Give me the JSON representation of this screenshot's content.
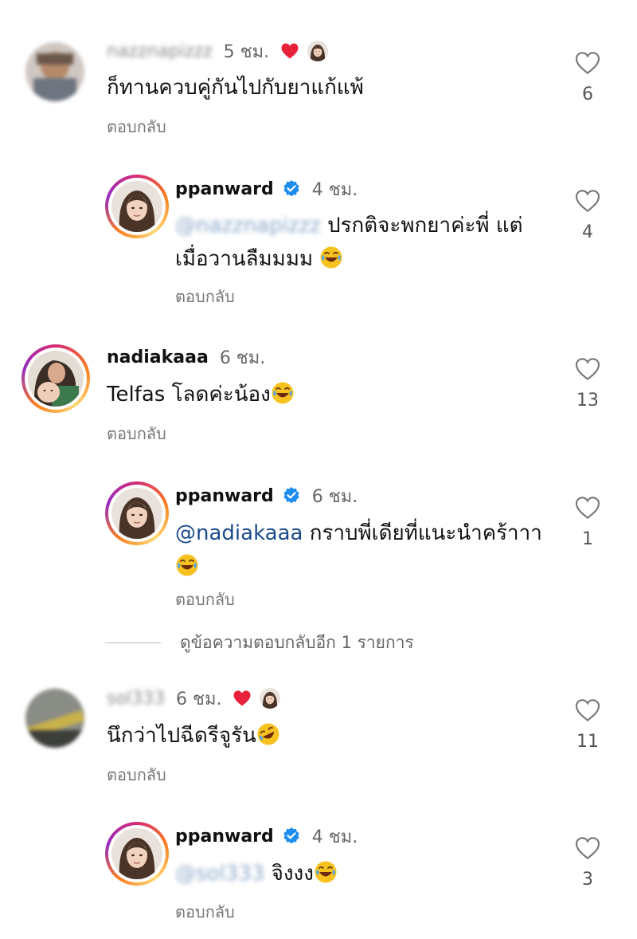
{
  "comments": [
    {
      "username": "nazznapizzz",
      "time": "5 ชม.",
      "text": "ก็ทานควบคู่กันไปกับยาแก้แพ้",
      "reply_label": "ตอบกลับ",
      "likes": "6",
      "liked_by_author": true
    },
    {
      "username": "ppanward",
      "verified": true,
      "time": "4 ชม.",
      "mention": "@nazznapizzz",
      "text_line1": "ปรกติจะพกยาค่ะพี่ แต่",
      "text_line2": "เมื่อวานลืมมมม",
      "reply_label": "ตอบกลับ",
      "likes": "4"
    },
    {
      "username": "nadiakaaa",
      "time": "6 ชม.",
      "text": "Telfas โลดค่ะน้อง",
      "reply_label": "ตอบกลับ",
      "likes": "13"
    },
    {
      "username": "ppanward",
      "verified": true,
      "time": "6 ชม.",
      "mention": "@nadiakaaa",
      "text": "กราบพี่เดียที่แนะนำคร้าาา",
      "reply_label": "ตอบกลับ",
      "likes": "1"
    },
    {
      "username": "sol333",
      "time": "6 ชม.",
      "text": "นึกว่าไปฉีดรีจูรัน",
      "reply_label": "ตอบกลับ",
      "likes": "11",
      "liked_by_author": true
    },
    {
      "username": "ppanward",
      "verified": true,
      "time": "4 ชม.",
      "mention": "@sol333",
      "text": "จิงงง",
      "reply_label": "ตอบกลับ",
      "likes": "3"
    }
  ],
  "view_more_replies": "ดูข้อความตอบกลับอีก 1 รายการ",
  "colors": {
    "heart_red": "#e8213b",
    "verified_blue": "#1d8cf0",
    "mention_blue": "#1b4a8a"
  }
}
